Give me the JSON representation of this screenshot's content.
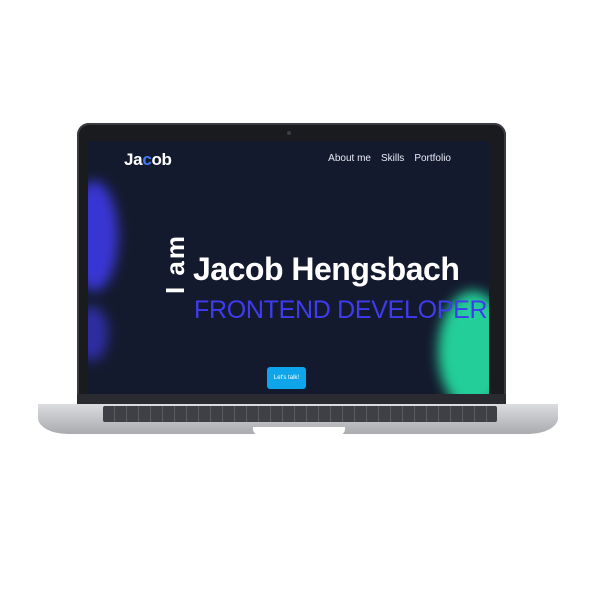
{
  "header": {
    "logo_part1": "Ja",
    "logo_part2": "c",
    "logo_part3": "ob",
    "nav": [
      {
        "label": "About me"
      },
      {
        "label": "Skills"
      },
      {
        "label": "Portfolio"
      }
    ]
  },
  "hero": {
    "intro": "I am",
    "name": "Jacob Hengsbach",
    "role": "FRONTEND DEVELOPER",
    "cta_label": "Let's talk!"
  },
  "colors": {
    "background": "#141a2e",
    "accent_blue": "#3f3bf0",
    "accent_green": "#25e2a4",
    "button": "#0ea5ea"
  }
}
